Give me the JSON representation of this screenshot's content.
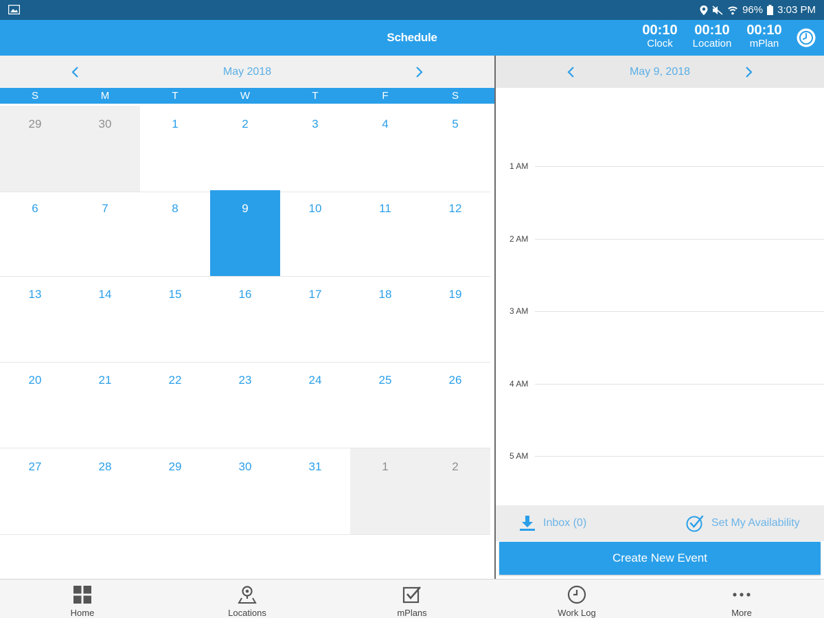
{
  "status_bar": {
    "battery": "96%",
    "time": "3:03 PM"
  },
  "app_bar": {
    "title": "Schedule",
    "timers": [
      {
        "value": "00:10",
        "label": "Clock"
      },
      {
        "value": "00:10",
        "label": "Location"
      },
      {
        "value": "00:10",
        "label": "mPlan"
      }
    ]
  },
  "calendar": {
    "month_label": "May 2018",
    "weekdays": [
      "S",
      "M",
      "T",
      "W",
      "T",
      "F",
      "S"
    ],
    "weeks": [
      [
        {
          "d": "29",
          "other": true
        },
        {
          "d": "30",
          "other": true
        },
        {
          "d": "1"
        },
        {
          "d": "2"
        },
        {
          "d": "3"
        },
        {
          "d": "4"
        },
        {
          "d": "5"
        }
      ],
      [
        {
          "d": "6"
        },
        {
          "d": "7"
        },
        {
          "d": "8"
        },
        {
          "d": "9",
          "selected": true
        },
        {
          "d": "10"
        },
        {
          "d": "11"
        },
        {
          "d": "12"
        }
      ],
      [
        {
          "d": "13"
        },
        {
          "d": "14"
        },
        {
          "d": "15"
        },
        {
          "d": "16"
        },
        {
          "d": "17"
        },
        {
          "d": "18"
        },
        {
          "d": "19"
        }
      ],
      [
        {
          "d": "20"
        },
        {
          "d": "21"
        },
        {
          "d": "22"
        },
        {
          "d": "23"
        },
        {
          "d": "24"
        },
        {
          "d": "25"
        },
        {
          "d": "26"
        }
      ],
      [
        {
          "d": "27"
        },
        {
          "d": "28"
        },
        {
          "d": "29"
        },
        {
          "d": "30"
        },
        {
          "d": "31"
        },
        {
          "d": "1",
          "other": true
        },
        {
          "d": "2",
          "other": true
        }
      ]
    ]
  },
  "day_view": {
    "date_label": "May 9, 2018",
    "hours": [
      "1 AM",
      "2 AM",
      "3 AM",
      "4 AM",
      "5 AM"
    ],
    "inbox_label": "Inbox (0)",
    "availability_label": "Set My Availability",
    "create_label": "Create New Event"
  },
  "bottom_nav": {
    "items": [
      {
        "label": "Home",
        "icon": "grid-icon"
      },
      {
        "label": "Locations",
        "icon": "location-pin-icon"
      },
      {
        "label": "mPlans",
        "icon": "checkbox-icon"
      },
      {
        "label": "Work Log",
        "icon": "clock-icon"
      },
      {
        "label": "More",
        "icon": "more-dots-icon"
      }
    ]
  },
  "colors": {
    "status_bar": "#1a5f8d",
    "primary": "#2a9fe9",
    "muted_day_bg": "#f0f0f0"
  }
}
